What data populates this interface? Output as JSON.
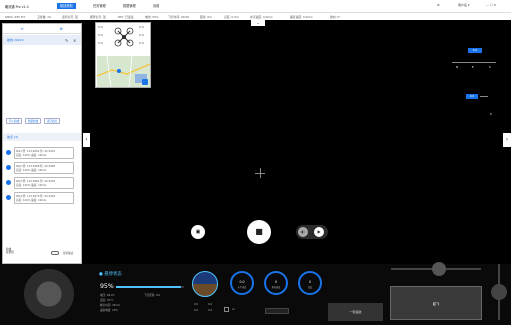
{
  "topbar": {
    "app_title": "瞰测通 Pro v1.0",
    "tabs": [
      "航线规划",
      "任务管理",
      "数据管理",
      "设置"
    ],
    "active_tab": 0,
    "right_items": [
      "⚙",
      "用户名 ▾",
      "— ☐ ✕"
    ]
  },
  "status": {
    "items": [
      "GNSS: RTK FIX",
      "卫星数: 24",
      "遥控信号: 强",
      "图传信号: 强",
      "RTK: 已连接",
      "电池: 95%",
      "飞行时间: 00:00",
      "距离: 0m",
      "高度: 0.0m",
      "水平速度: 0.0m/s",
      "垂直速度: 0.0m/s",
      "航向: 0°"
    ]
  },
  "sidebar": {
    "tab_left": "≡",
    "tab_right": "⊕",
    "item_label": "航线 20240",
    "edit_icon": "✎",
    "delete_icon": "✕",
    "buttons": [
      "导入航线",
      "新建航线",
      "清空航点"
    ],
    "section_label": "航点 (4)",
    "waypoints": [
      {
        "l1": "Wp1 经: 113.9452 纬: 22.5431",
        "l2": "高度: 120m  速度: 10m/s"
      },
      {
        "l1": "Wp2 经: 113.9468 纬: 22.5440",
        "l2": "高度: 120m  速度: 10m/s"
      },
      {
        "l1": "Wp3 经: 113.9481 纬: 22.5432",
        "l2": "高度: 120m  速度: 10m/s"
      },
      {
        "l1": "Wp4 经: 113.9470 纬: 22.5418",
        "l2": "高度: 120m  速度: 10m/s"
      }
    ],
    "bottom_text": "航线\n总里程",
    "toggle_label": "显示航点"
  },
  "drone_panel": {
    "stats": [
      "0 %",
      "0 %",
      "0 %",
      "0 %",
      "0 %",
      "0 %"
    ]
  },
  "hud": {
    "alt_top": "0.0",
    "alt_mid": "0.0",
    "compass_marks": [
      "N",
      "E",
      "S"
    ],
    "tick_label": "0"
  },
  "camera": {
    "photo_label": "▣",
    "record_label": "■",
    "mode_a": "◐",
    "mode_b": "▶"
  },
  "bottom": {
    "flight_status": "● 悬停状态",
    "battery_pct": "95%",
    "battery_fill": 0.95,
    "tele_left": [
      "电压: 48.2V",
      "温度: 32°C",
      "剩余时间: 25min",
      "返航电量: 20%"
    ],
    "tele_right": [
      "飞行距离: 0m"
    ],
    "gauges": [
      {
        "val": "0.0",
        "cap": "水平速度"
      },
      {
        "val": "0",
        "cap": "垂直速度"
      },
      {
        "val": "0",
        "cap": "高度"
      }
    ],
    "field_small": "",
    "btn_left": "一键返航",
    "btn_right": "起飞",
    "tele_bottom": [
      "0.0",
      "0.0",
      "0.0",
      "0.0"
    ]
  },
  "colors": {
    "accent": "#1a73e8",
    "status_blue": "#4fc3ff"
  }
}
